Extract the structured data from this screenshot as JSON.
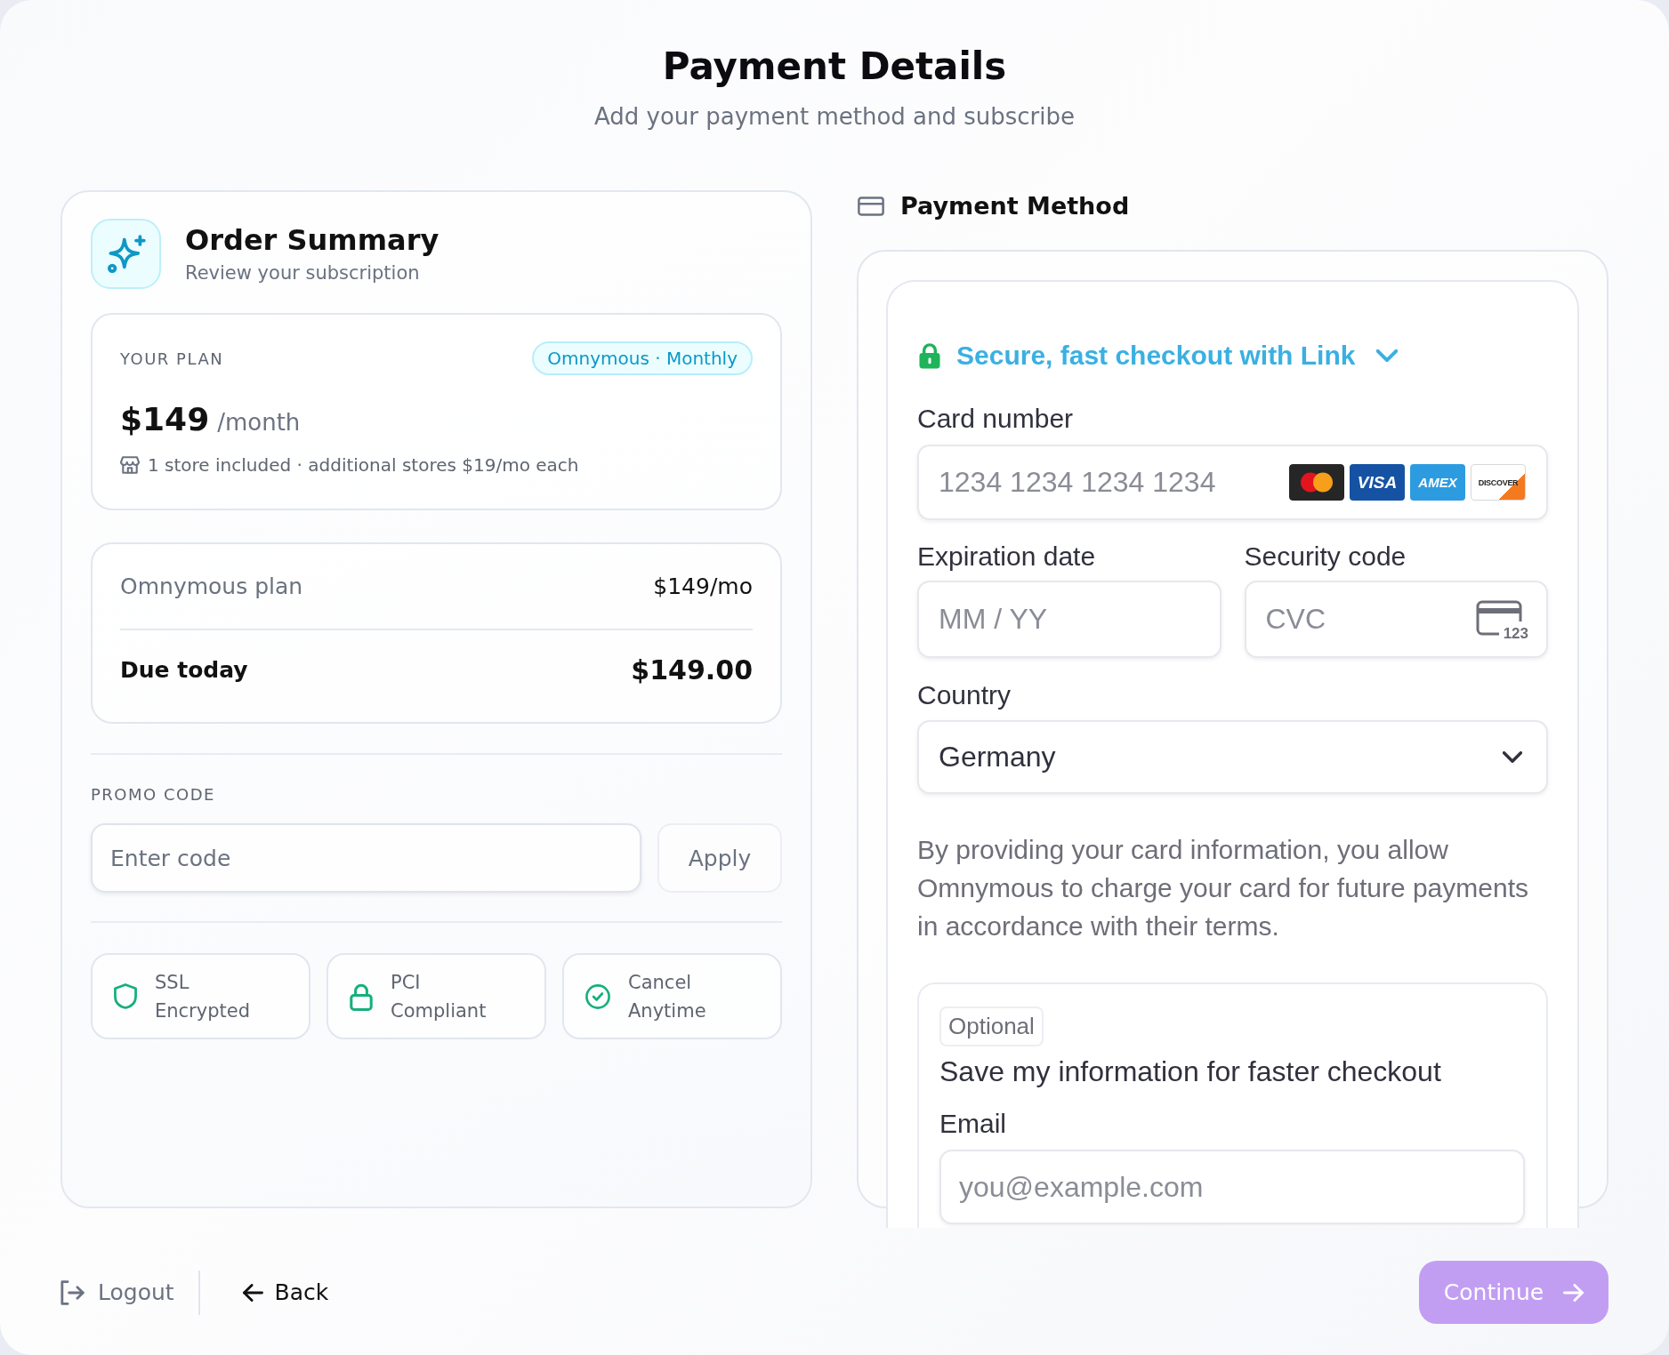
{
  "header": {
    "title": "Payment Details",
    "subtitle": "Add your payment method and subscribe"
  },
  "order_summary": {
    "title": "Order Summary",
    "subtitle": "Review your subscription",
    "plan": {
      "label": "YOUR PLAN",
      "badge": "Omnymous · Monthly",
      "price": "$149",
      "period": "/month",
      "note": "1 store included · additional stores $19/mo each"
    },
    "lines": [
      {
        "kind": "item",
        "label": "Omnymous plan",
        "amount": "$149/mo"
      },
      {
        "kind": "total",
        "label": "Due today",
        "amount": "$149.00"
      }
    ],
    "promo": {
      "label": "PROMO CODE",
      "placeholder": "Enter code",
      "button": "Apply"
    },
    "features": [
      {
        "kind": "shield",
        "label": "SSL Encrypted"
      },
      {
        "kind": "lock",
        "label": "PCI Compliant"
      },
      {
        "kind": "check",
        "label": "Cancel Anytime"
      }
    ]
  },
  "payment_method": {
    "title": "Payment Method",
    "link": "Secure, fast checkout with Link",
    "card_number": {
      "label": "Card number",
      "placeholder": "1234 1234 1234 1234",
      "logos": [
        {
          "kind": "mastercard"
        },
        {
          "kind": "visa",
          "text": "VISA"
        },
        {
          "kind": "amex",
          "text": "AMEX"
        },
        {
          "kind": "discover",
          "text": "DISCOVER"
        }
      ]
    },
    "expiry": {
      "label": "Expiration date",
      "placeholder": "MM / YY"
    },
    "security_code": {
      "label": "Security code",
      "placeholder": "CVC",
      "icon_text": "123"
    },
    "country": {
      "label": "Country",
      "value": "Germany"
    },
    "disclaimer": "By providing your card information, you allow Omnymous to charge your card for future payments in accordance with their terms.",
    "save": {
      "tag": "Optional",
      "text": "Save my information for faster checkout",
      "email_label": "Email",
      "email_placeholder": "you@example.com"
    }
  },
  "footer": {
    "logout": "Logout",
    "back": "Back",
    "continue": {
      "label": "Continue",
      "disabled": true
    }
  }
}
